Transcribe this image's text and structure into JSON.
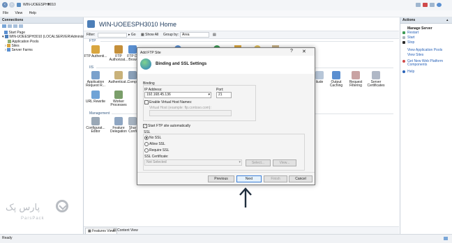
{
  "address": {
    "path": "WIN-UOEESPH3010"
  },
  "menu": {
    "items": [
      "File",
      "View",
      "Help"
    ]
  },
  "connections": {
    "title": "Connections",
    "tree": [
      "Start Page",
      "WIN-UOEESPH3010 (LOCALSERVER\\Administrato",
      "Application Pools",
      "Sites",
      "Server Farms"
    ]
  },
  "center": {
    "title": "WIN-UOEESPH3010 Home",
    "filter_label": "Filter:",
    "go_label": "Go",
    "show_all": "Show All",
    "group_by_label": "Group by:",
    "group_by_value": "Area",
    "sections": [
      "FTP",
      "IIS",
      "Management"
    ],
    "ftp_features": [
      "FTP Authenti...",
      "FTP Authorizat...",
      "FTP Di Brow"
    ],
    "iis_features": [
      "Application Request R...",
      "Authenticat...",
      "Compr",
      "ilude",
      "Output Caching",
      "Request Filtering",
      "Server Certificates"
    ],
    "iis_features_row2": [
      "URL Rewrite",
      "Worker Processes"
    ],
    "mgmt_features": [
      "Configurat... Editor",
      "Feature Delegation",
      "Shar Confi"
    ]
  },
  "actions": {
    "title": "Actions",
    "subtitle": "Manage Server",
    "items": [
      "Restart",
      "Start",
      "Stop",
      "View Application Pools",
      "View Sites",
      "Get New Web Platform Components",
      "Help"
    ]
  },
  "tabs": {
    "features_view": "Features View",
    "content_view": "Content View"
  },
  "status": {
    "text": "Ready"
  },
  "dialog": {
    "title": "Add FTP Site",
    "heading": "Binding and SSL Settings",
    "binding_label": "Binding",
    "ip_label": "IP Address:",
    "ip_value": "192.168.45.136",
    "port_label": "Port:",
    "port_value": "21",
    "vhost_checkbox": "Enable Virtual Host Names:",
    "vhost_label": "Virtual Host (example: ftp.contoso.com):",
    "autostart": "Start FTP site automatically",
    "ssl_label": "SSL",
    "ssl_options": [
      "No SSL",
      "Allow SSL",
      "Require SSL"
    ],
    "ssl_selected": 0,
    "cert_label": "SSL Certificate:",
    "cert_value": "Not Selected",
    "select_button": "Select...",
    "view_button": "View...",
    "buttons": {
      "previous": "Previous",
      "next": "Next",
      "finish": "Finish",
      "cancel": "Cancel"
    }
  },
  "watermark": {
    "brand_fa": "پارس پک",
    "brand_en": "ParsPack"
  },
  "colors": {
    "accent": "#2a63b8",
    "selected_border": "#3c7fd8",
    "arrow": "#1f2d3d"
  }
}
